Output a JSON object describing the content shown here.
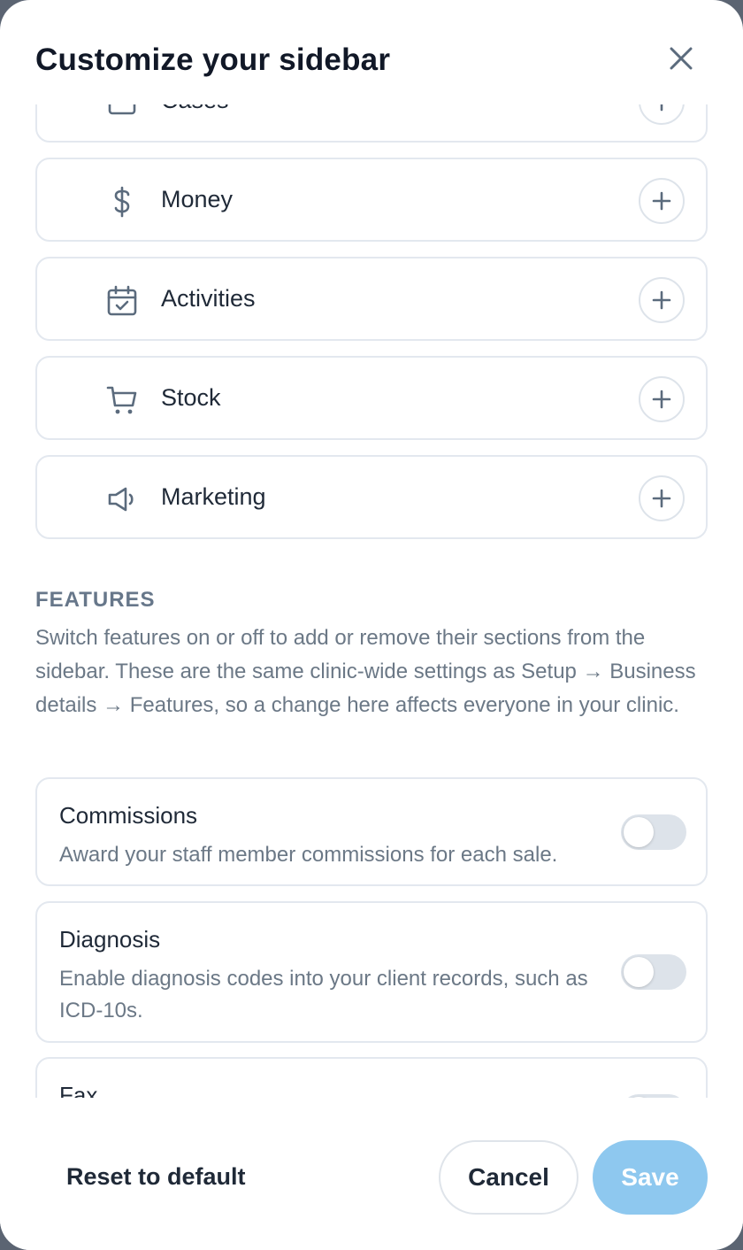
{
  "modal": {
    "title": "Customize your sidebar"
  },
  "nav_items": [
    {
      "label": "Cases",
      "icon": "folder-icon"
    },
    {
      "label": "Money",
      "icon": "dollar-icon"
    },
    {
      "label": "Activities",
      "icon": "calendar-check-icon"
    },
    {
      "label": "Stock",
      "icon": "cart-icon"
    },
    {
      "label": "Marketing",
      "icon": "megaphone-icon"
    }
  ],
  "features": {
    "heading": "FEATURES",
    "description": "Switch features on or off to add or remove their sections from the sidebar. These are the same clinic-wide settings as Setup → Business details → Features, so a change here affects everyone in your clinic.",
    "items": [
      {
        "title": "Commissions",
        "description": "Award your staff member commissions for each sale.",
        "enabled": false
      },
      {
        "title": "Diagnosis",
        "description": "Enable diagnosis codes into your client records, such as ICD-10s.",
        "enabled": false
      },
      {
        "title": "Fax",
        "description": "",
        "enabled": false
      }
    ]
  },
  "footer": {
    "reset_label": "Reset to default",
    "cancel_label": "Cancel",
    "save_label": "Save"
  },
  "colors": {
    "save_button": "#8ec8ef",
    "icon": "#5b6b7d",
    "border": "#e3e8ef"
  }
}
